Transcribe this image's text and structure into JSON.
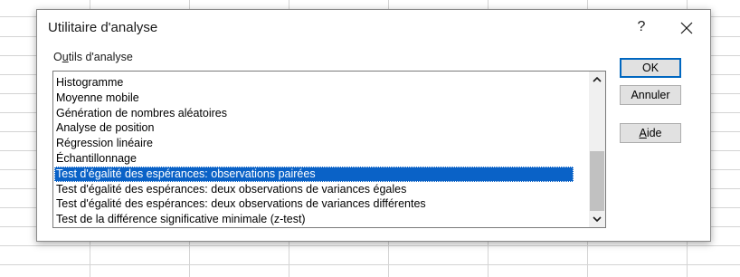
{
  "dialog": {
    "title": "Utilitaire d'analyse",
    "help_label": "?",
    "close_icon": "close-icon"
  },
  "tools_label": {
    "accel": "u",
    "prefix": "O",
    "suffix": "tils d'analyse"
  },
  "list": {
    "items": [
      "Histogramme",
      "Moyenne mobile",
      "Génération de nombres aléatoires",
      "Analyse de position",
      "Régression linéaire",
      "Échantillonnage",
      "Test d'égalité des espérances: observations pairées",
      "Test d'égalité des espérances: deux observations de variances égales",
      "Test d'égalité des espérances: deux observations de variances différentes",
      "Test de la différence significative minimale (z-test)"
    ],
    "selected_index": 6,
    "scroll_up_icon": "chevron-up-icon",
    "scroll_down_icon": "chevron-down-icon"
  },
  "buttons": {
    "ok": "OK",
    "cancel": "Annuler",
    "help_accel": "A",
    "help_rest": "ide"
  },
  "colors": {
    "selection": "#0a62c7",
    "default_button_border": "#0067c0"
  }
}
